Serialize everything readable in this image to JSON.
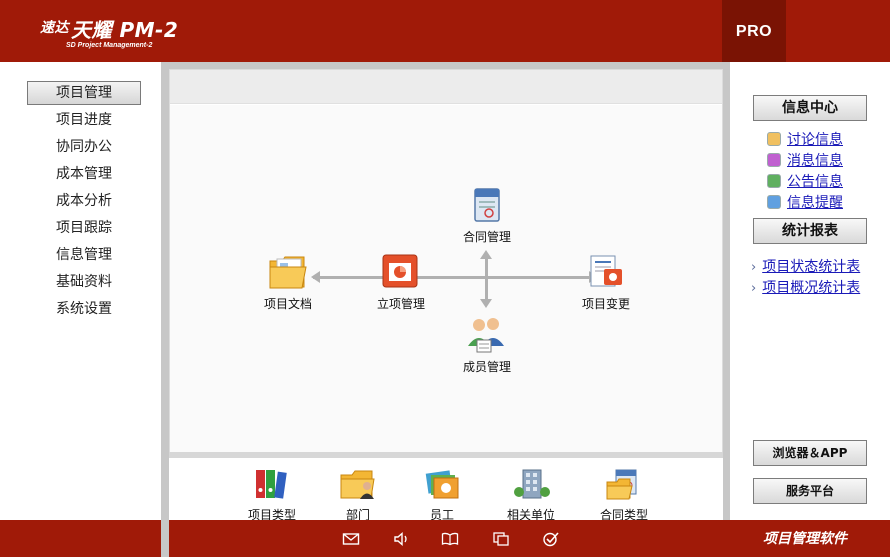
{
  "header": {
    "logo_small": "速达",
    "logo_main": "天耀 PM-2",
    "logo_sub": "SD Project Management-2",
    "edition": "PRO"
  },
  "nav": {
    "items": [
      {
        "label": "项目管理",
        "active": true
      },
      {
        "label": "项目进度"
      },
      {
        "label": "协同办公"
      },
      {
        "label": "成本管理"
      },
      {
        "label": "成本分析"
      },
      {
        "label": "项目跟踪"
      },
      {
        "label": "信息管理"
      },
      {
        "label": "基础资料"
      },
      {
        "label": "系统设置"
      }
    ]
  },
  "diagram": {
    "contract": "合同管理",
    "project_docs": "项目文档",
    "project_setup": "立项管理",
    "project_change": "项目变更",
    "members": "成员管理"
  },
  "bottom_bar": {
    "items": [
      {
        "label": "项目类型"
      },
      {
        "label": "部门"
      },
      {
        "label": "员工"
      },
      {
        "label": "相关单位"
      },
      {
        "label": "合同类型"
      }
    ]
  },
  "right_panel": {
    "info_center": "信息中心",
    "info_links": [
      {
        "label": "讨论信息",
        "color": "#f0c060"
      },
      {
        "label": "消息信息",
        "color": "#c060d0"
      },
      {
        "label": "公告信息",
        "color": "#60b060"
      },
      {
        "label": "信息提醒",
        "color": "#60a0e0"
      }
    ],
    "reports": "统计报表",
    "report_links": [
      {
        "label": "项目状态统计表"
      },
      {
        "label": "项目概况统计表"
      }
    ],
    "browser_app": "浏览器＆APP",
    "service_platform": "服务平台"
  },
  "footer": {
    "title": "项目管理软件"
  },
  "colors": {
    "brand_red": "#a01a08",
    "brand_dark": "#7a1304",
    "link_blue": "#1a1ab8"
  }
}
